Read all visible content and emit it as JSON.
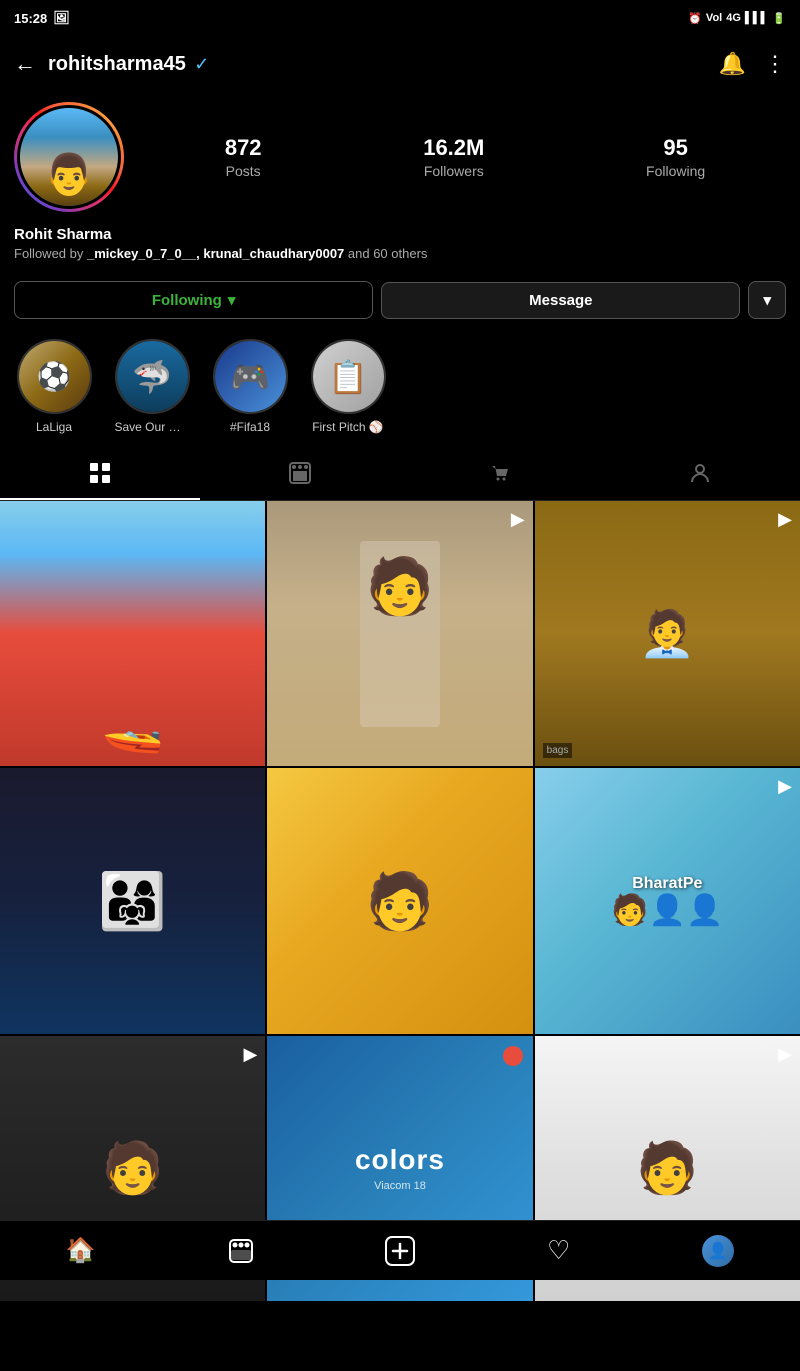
{
  "statusBar": {
    "time": "15:28",
    "icons": [
      "photo-icon",
      "alarm-icon",
      "voi-icon",
      "4g-icon",
      "signal-icon",
      "battery-icon"
    ]
  },
  "topNav": {
    "backLabel": "←",
    "username": "rohitsharma45",
    "verifiedLabel": "✓",
    "notificationLabel": "🔔",
    "menuLabel": "⋮"
  },
  "profile": {
    "stats": {
      "posts": {
        "number": "872",
        "label": "Posts"
      },
      "followers": {
        "number": "16.2M",
        "label": "Followers"
      },
      "following": {
        "number": "95",
        "label": "Following"
      }
    },
    "name": "Rohit Sharma",
    "followedByText": "Followed by ",
    "followedByUsers": "_mickey_0_7_0__, krunal_chaudhary0007",
    "followedBySuffix": " and 60 others"
  },
  "buttons": {
    "following": "Following",
    "followingChevron": "▾",
    "message": "Message",
    "dropdown": "▾"
  },
  "stories": [
    {
      "label": "LaLiga",
      "icon": "⚽",
      "bgType": "laliga"
    },
    {
      "label": "Save Our Oc...",
      "icon": "🦈",
      "bgType": "ocean"
    },
    {
      "label": "#Fifa18",
      "icon": "🎮",
      "bgType": "fifa"
    },
    {
      "label": "First Pitch ⚾",
      "icon": "📋",
      "bgType": "pitch"
    }
  ],
  "tabs": [
    {
      "icon": "⊞",
      "active": true,
      "name": "grid"
    },
    {
      "icon": "▶",
      "active": false,
      "name": "reels"
    },
    {
      "icon": "🛍",
      "active": false,
      "name": "shop"
    },
    {
      "icon": "👤",
      "active": false,
      "name": "tagged"
    }
  ],
  "gridItems": [
    {
      "hasVideo": false,
      "imgClass": "img-1"
    },
    {
      "hasVideo": true,
      "imgClass": "img-2"
    },
    {
      "hasVideo": true,
      "imgClass": "img-3"
    },
    {
      "hasVideo": false,
      "imgClass": "img-4"
    },
    {
      "hasVideo": false,
      "imgClass": "img-5"
    },
    {
      "hasVideo": true,
      "imgClass": "img-6"
    },
    {
      "hasVideo": true,
      "imgClass": "img-7"
    },
    {
      "hasVideo": false,
      "imgClass": "img-8"
    },
    {
      "hasVideo": true,
      "imgClass": "img-9"
    }
  ],
  "bottomNav": {
    "home": "🏠",
    "reels": "▶",
    "add": "⊕",
    "heart": "♡",
    "profileEmoji": "👤"
  }
}
